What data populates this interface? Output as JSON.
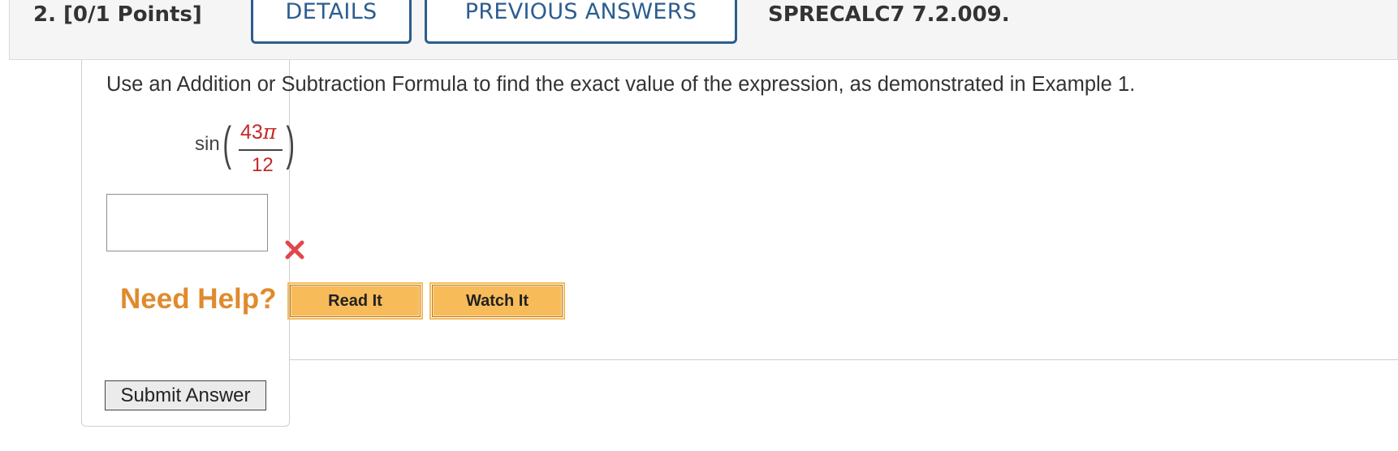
{
  "header": {
    "question_label": "2.  [0/1 Points]",
    "tabs": [
      {
        "label": "DETAILS"
      },
      {
        "label": "PREVIOUS ANSWERS"
      }
    ],
    "problem_code": "SPRECALC7 7.2.009."
  },
  "question": {
    "instructions": "Use an Addition or Subtraction Formula to find the exact value of the expression, as demonstrated in Example 1.",
    "expression": {
      "function": "sin",
      "numerator_value": "43",
      "numerator_symbol": "π",
      "denominator": "12"
    }
  },
  "answer": {
    "value": "",
    "placeholder": "",
    "status_icon": "incorrect-x-icon",
    "status_color": "#e0474c"
  },
  "help": {
    "label": "Need Help?",
    "buttons": [
      {
        "label": "Read It"
      },
      {
        "label": "Watch It"
      }
    ]
  },
  "submit": {
    "label": "Submit Answer"
  },
  "colors": {
    "accent": "#2c5d8f",
    "help": "#e08a2e",
    "fraction": "#c62828",
    "help_button": "#f7bb5a"
  }
}
